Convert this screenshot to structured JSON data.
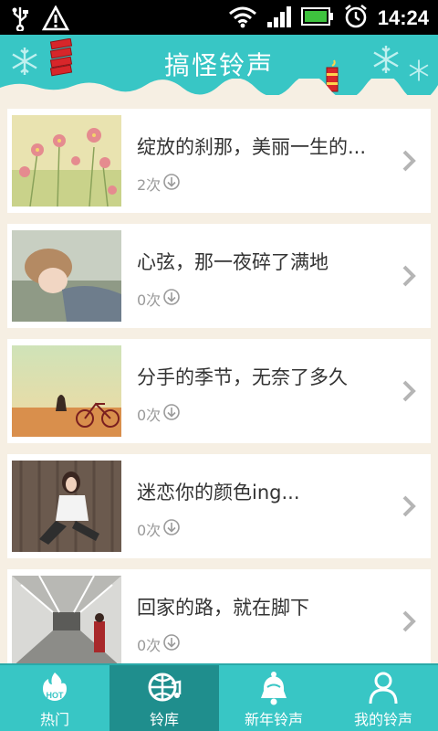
{
  "status_bar": {
    "time": "14:24",
    "icons": [
      "usb-icon",
      "warning-icon",
      "wifi-icon",
      "signal-icon",
      "battery-icon",
      "alarm-icon"
    ]
  },
  "header": {
    "title": "搞怪铃声"
  },
  "colors": {
    "accent": "#38c6c5",
    "tab_active": "#1f8e8d",
    "background": "#f6efe3"
  },
  "list": {
    "items": [
      {
        "title": "绽放的刹那，美丽一生的...",
        "count": "2次",
        "image": "cosmos-flowers-photo"
      },
      {
        "title": "心弦，那一夜碎了满地",
        "count": "0次",
        "image": "girl-lying-photo"
      },
      {
        "title": "分手的季节，无奈了多久",
        "count": "0次",
        "image": "bicycle-sunset-photo"
      },
      {
        "title": "迷恋你的颜色ing...",
        "count": "0次",
        "image": "woman-sitting-photo"
      },
      {
        "title": "回家的路，就在脚下",
        "count": "0次",
        "image": "subway-corridor-photo"
      }
    ]
  },
  "tabs": [
    {
      "label": "热门",
      "icon": "hot-flame-icon",
      "active": false
    },
    {
      "label": "铃库",
      "icon": "globe-music-icon",
      "active": true
    },
    {
      "label": "新年铃声",
      "icon": "bell-icon",
      "active": false
    },
    {
      "label": "我的铃声",
      "icon": "person-icon",
      "active": false
    }
  ]
}
